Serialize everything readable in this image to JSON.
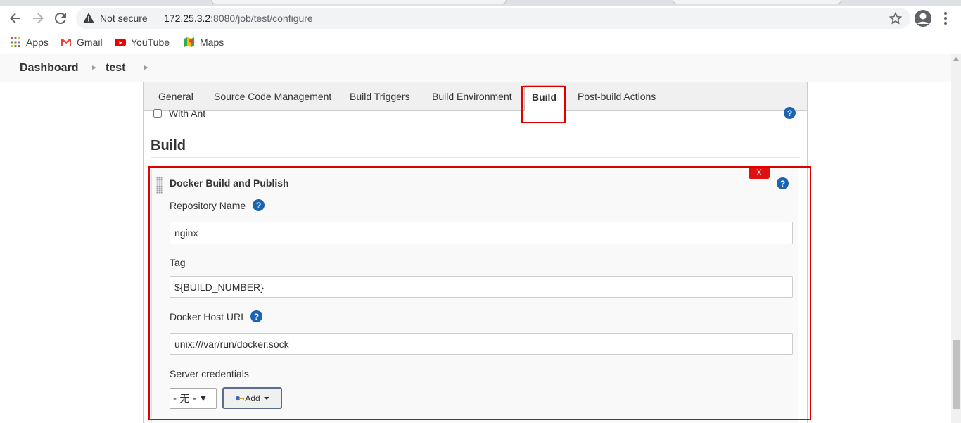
{
  "browser": {
    "security_label": "Not secure",
    "url_host": "172.25.3.2",
    "url_rest": ":8080/job/test/configure"
  },
  "bookmarks": [
    {
      "label": "Apps",
      "icon": "apps-grid-icon"
    },
    {
      "label": "Gmail",
      "icon": "gmail-icon"
    },
    {
      "label": "YouTube",
      "icon": "youtube-icon"
    },
    {
      "label": "Maps",
      "icon": "maps-icon"
    }
  ],
  "breadcrumb": [
    "Dashboard",
    "test"
  ],
  "tabs": [
    "General",
    "Source Code Management",
    "Build Triggers",
    "Build Environment",
    "Build",
    "Post-build Actions"
  ],
  "active_tab": "Build",
  "ant_option": "With Ant",
  "section_title": "Build",
  "step": {
    "title": "Docker Build and Publish",
    "delete_label": "X",
    "repository_label": "Repository Name",
    "repository_value": "nginx",
    "tag_label": "Tag",
    "tag_value": "${BUILD_NUMBER}",
    "docker_host_label": "Docker Host URI",
    "docker_host_value": "unix:///var/run/docker.sock",
    "credentials_label": "Server credentials",
    "credentials_selected": "- 无 -",
    "add_label": "Add"
  },
  "help_glyph": "?",
  "colors": {
    "help_blue": "#1b64b3",
    "highlight_red": "#e00000",
    "delete_red": "#d11111"
  }
}
